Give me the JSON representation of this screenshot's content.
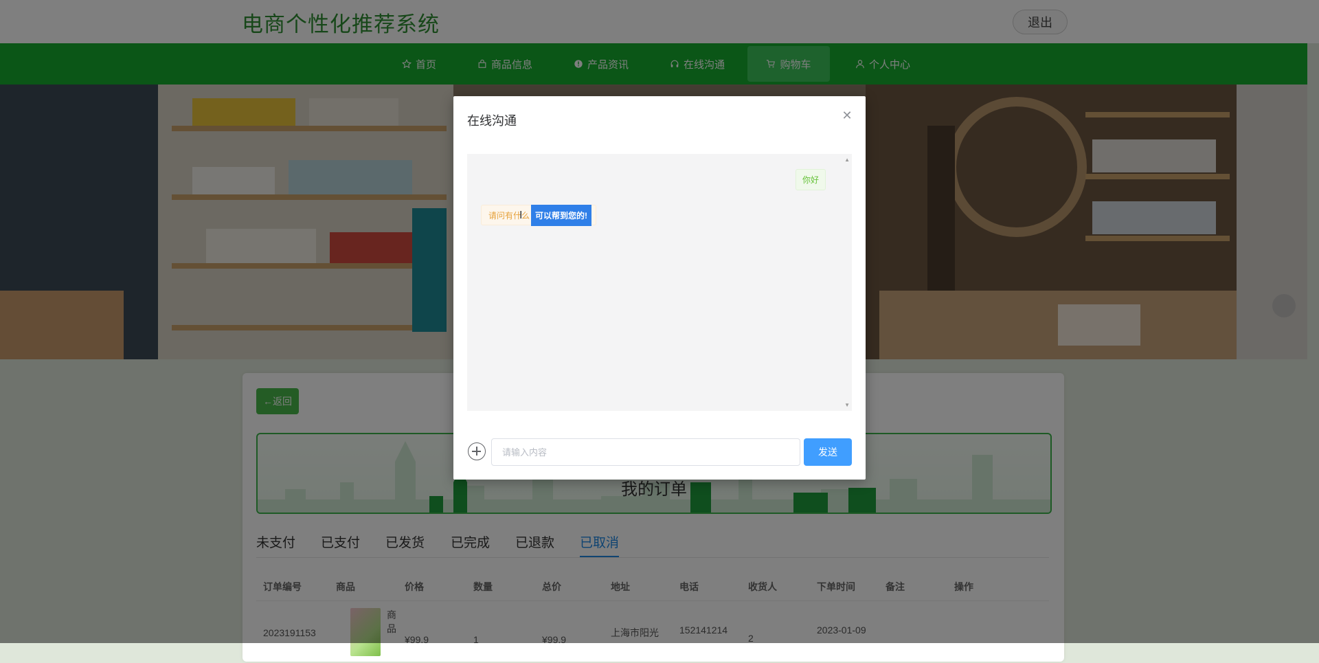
{
  "header": {
    "title": "电商个性化推荐系统",
    "logout_label": "退出"
  },
  "nav": {
    "items": [
      {
        "label": "首页",
        "icon": "star-icon"
      },
      {
        "label": "商品信息",
        "icon": "bag-icon"
      },
      {
        "label": "产品资讯",
        "icon": "info-icon"
      },
      {
        "label": "在线沟通",
        "icon": "headset-icon"
      },
      {
        "label": "购物车",
        "icon": "cart-icon",
        "active": true
      },
      {
        "label": "个人中心",
        "icon": "user-icon"
      }
    ],
    "active_color": "#3cc45a",
    "bar_color": "#16ad2f"
  },
  "orders": {
    "back_label": "←返回",
    "banner_title": "我的订单",
    "tabs": [
      "未支付",
      "已支付",
      "已发货",
      "已完成",
      "已退款",
      "已取消"
    ],
    "active_tab": "已取消",
    "columns": [
      "订单编号",
      "商品",
      "价格",
      "数量",
      "总价",
      "地址",
      "电话",
      "收货人",
      "下单时间",
      "备注",
      "操作"
    ],
    "rows": [
      {
        "order_no": "2023191153",
        "product": "商品",
        "price": "¥99.9",
        "qty": "1",
        "total": "¥99.9",
        "address": "上海市阳光",
        "phone": "152141214",
        "receiver": "2",
        "time": "2023-01-09",
        "note": "",
        "action": ""
      }
    ]
  },
  "chat": {
    "title": "在线沟通",
    "messages": [
      {
        "side": "right",
        "text": "你好"
      },
      {
        "side": "left",
        "text_plain": "请问有什么",
        "text_selected": "可以帮到您的!"
      }
    ],
    "input_placeholder": "请输入内容",
    "input_value": "",
    "send_label": "发送"
  }
}
